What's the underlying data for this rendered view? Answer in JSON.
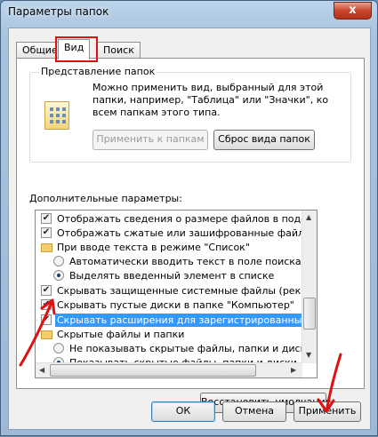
{
  "window": {
    "title": "Параметры папок",
    "close_glyph": "x"
  },
  "tabs": [
    {
      "label": "Общие"
    },
    {
      "label": "Вид",
      "active": true
    },
    {
      "label": "Поиск"
    }
  ],
  "folder_view": {
    "title": "Представление папок",
    "description": "Можно применить вид, выбранный для этой папки, например, \"Таблица\" или \"Значки\", ко всем папкам этого типа.",
    "apply_button": "Применить к папкам",
    "reset_button": "Сброс вида папок"
  },
  "advanced": {
    "label": "Дополнительные параметры:",
    "items": [
      {
        "type": "checkbox",
        "checked": true,
        "text": "Отображать сведения о размере файлов в подсказк"
      },
      {
        "type": "checkbox",
        "checked": true,
        "text": "Отображать сжатые или зашифрованные файлы NTI"
      },
      {
        "type": "folder",
        "text": "При вводе текста в режиме \"Список\""
      },
      {
        "type": "radio",
        "checked": false,
        "text": "Автоматически вводить текст в поле поиска"
      },
      {
        "type": "radio",
        "checked": true,
        "text": "Выделять введенный элемент в списке"
      },
      {
        "type": "checkbox",
        "checked": true,
        "text": "Скрывать защищенные системные файлы (рекомен,"
      },
      {
        "type": "checkbox",
        "checked": true,
        "text": "Скрывать пустые диски в папке \"Компьютер\""
      },
      {
        "type": "checkbox",
        "checked": true,
        "selected": true,
        "text": "Скрывать расширения для зарегистрированных типо"
      },
      {
        "type": "folder",
        "text": "Скрытые файлы и папки"
      },
      {
        "type": "radio",
        "checked": false,
        "text": "Не показывать скрытые файлы, папки и диски"
      },
      {
        "type": "radio",
        "checked": true,
        "text": "Показывать скрытые файлы, папки и диски"
      }
    ],
    "restore_button": "Восстановить умолчания"
  },
  "footer": {
    "ok": "ОК",
    "cancel": "Отмена",
    "apply": "Применить"
  },
  "annotation_color": "#e01010"
}
